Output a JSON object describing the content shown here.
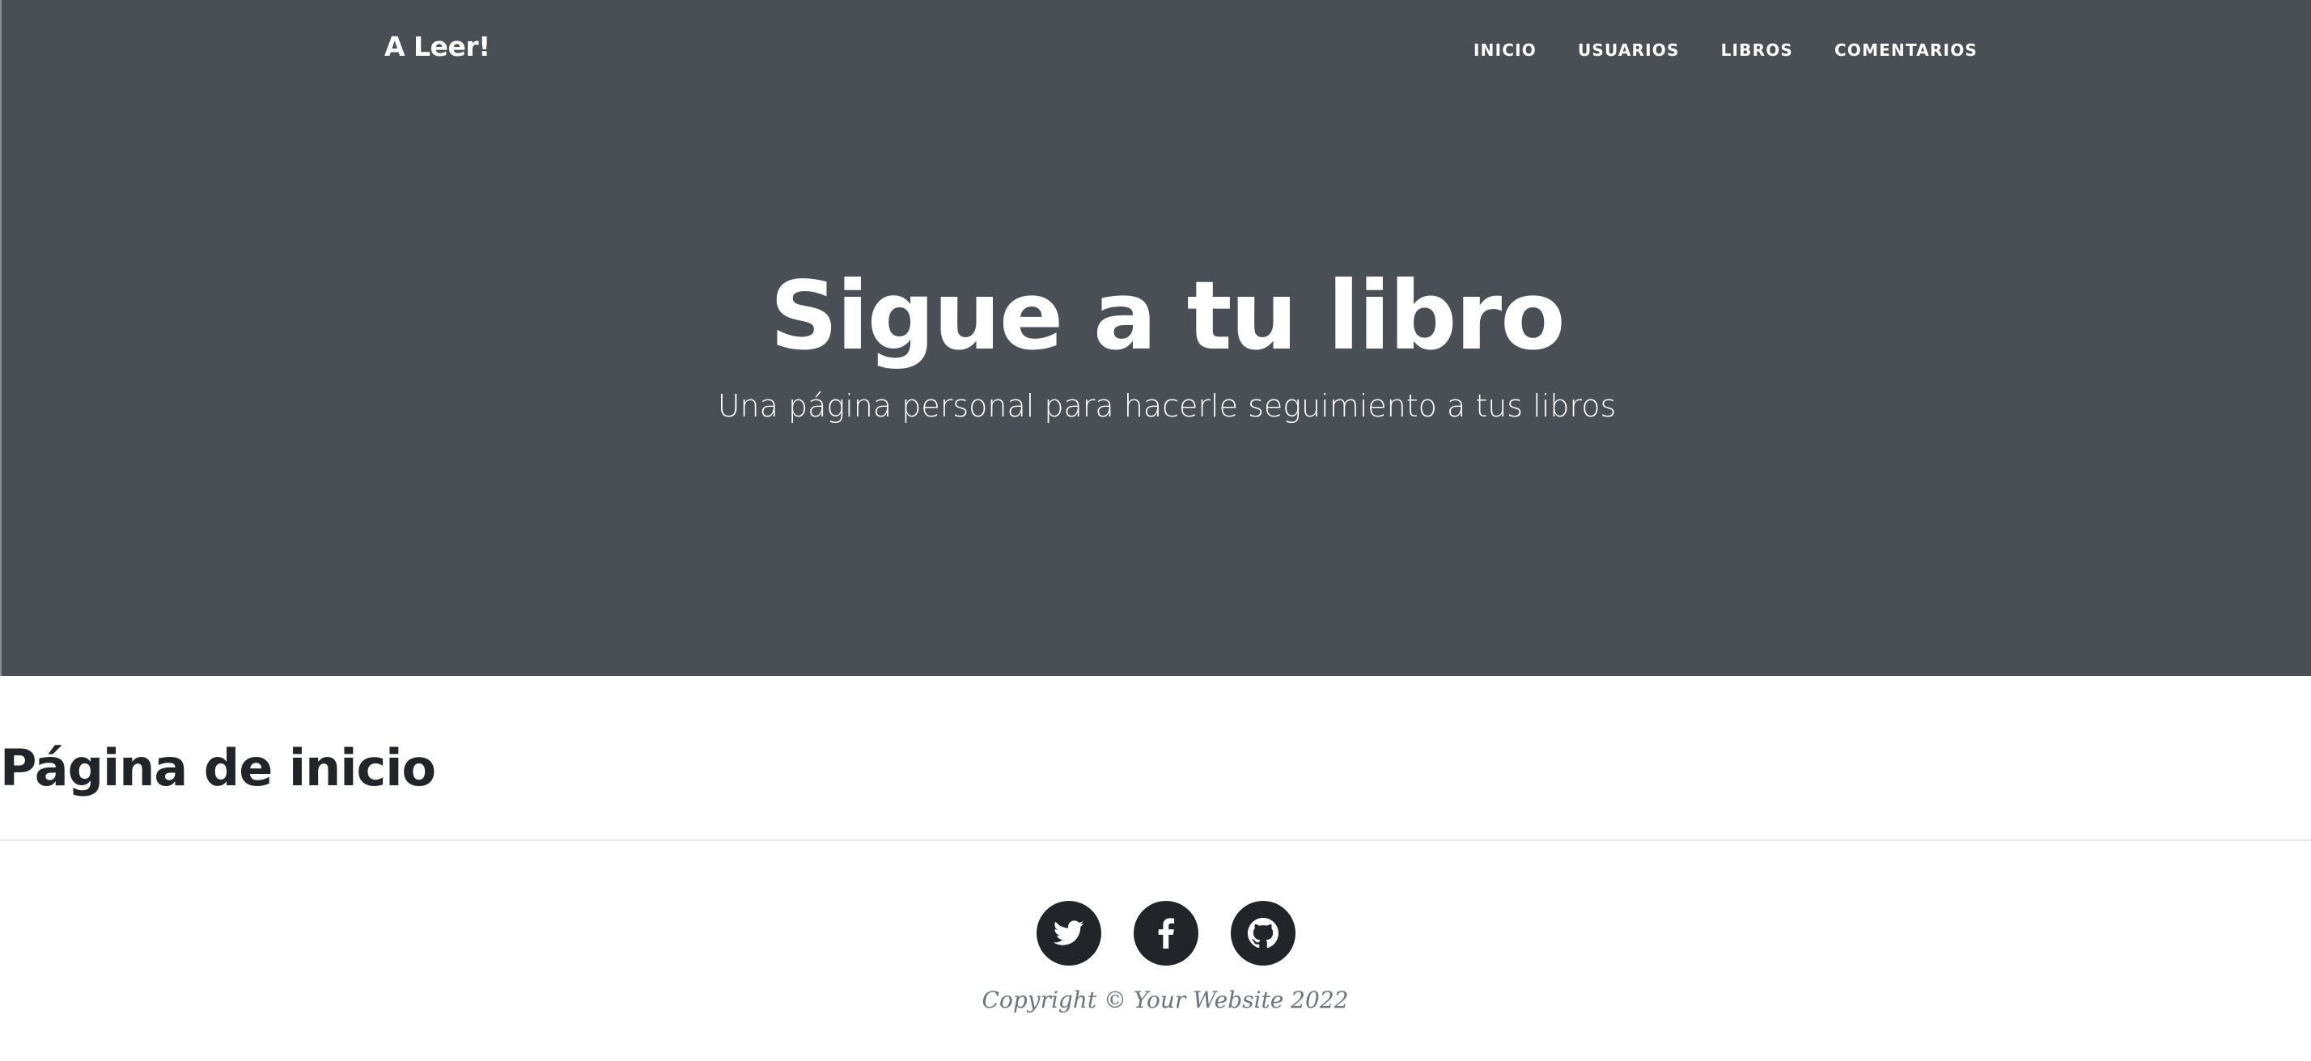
{
  "navbar": {
    "brand": "A Leer!",
    "links": [
      "INICIO",
      "USUARIOS",
      "LIBROS",
      "COMENTARIOS"
    ]
  },
  "hero": {
    "title": "Sigue a tu libro",
    "subtitle": "Una página personal para hacerle seguimiento a tus libros"
  },
  "main": {
    "heading": "Página de inicio"
  },
  "footer": {
    "social": [
      {
        "icon": "twitter-icon"
      },
      {
        "icon": "facebook-icon"
      },
      {
        "icon": "github-icon"
      }
    ],
    "copyright": "Copyright © Your Website 2022"
  },
  "colors": {
    "masthead_bg": "#4a4e55",
    "text_dark": "#212529",
    "muted": "#6c757d",
    "white": "#ffffff"
  }
}
